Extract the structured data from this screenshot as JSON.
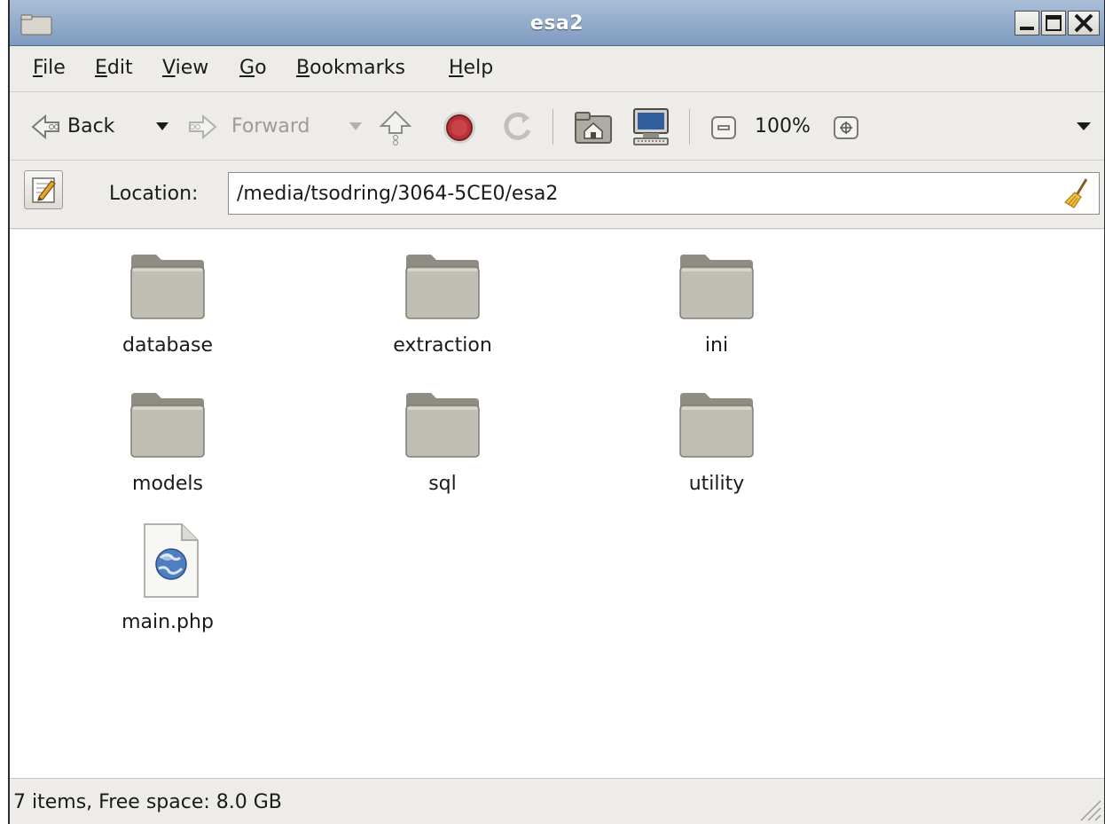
{
  "window": {
    "title": "esa2"
  },
  "menubar": {
    "items": [
      {
        "mnemonic": "F",
        "rest": "ile"
      },
      {
        "mnemonic": "E",
        "rest": "dit"
      },
      {
        "mnemonic": "V",
        "rest": "iew"
      },
      {
        "mnemonic": "G",
        "rest": "o"
      },
      {
        "mnemonic": "B",
        "rest": "ookmarks"
      },
      {
        "mnemonic": "H",
        "rest": "elp"
      }
    ]
  },
  "toolbar": {
    "back_label": "Back",
    "forward_label": "Forward",
    "zoom_level": "100%",
    "icons": [
      "back-arrow-icon",
      "dropdown-arrow-icon",
      "forward-arrow-icon",
      "up-arrow-icon",
      "stop-icon",
      "reload-icon",
      "home-folder-icon",
      "computer-icon",
      "zoom-out-icon",
      "zoom-in-icon",
      "toolbar-overflow-icon"
    ]
  },
  "location": {
    "label": "Location:",
    "path": "/media/tsodring/3064-5CE0/esa2"
  },
  "files": [
    {
      "name": "database",
      "type": "folder"
    },
    {
      "name": "extraction",
      "type": "folder"
    },
    {
      "name": "ini",
      "type": "folder"
    },
    {
      "name": "models",
      "type": "folder"
    },
    {
      "name": "sql",
      "type": "folder"
    },
    {
      "name": "utility",
      "type": "folder"
    },
    {
      "name": "main.php",
      "type": "php-file"
    }
  ],
  "statusbar": {
    "text": "7 items, Free space: 8.0 GB"
  },
  "colors": {
    "titlebar": "#7f9cc0",
    "folder": "#b8b6a9",
    "window_bg": "#edece9"
  }
}
